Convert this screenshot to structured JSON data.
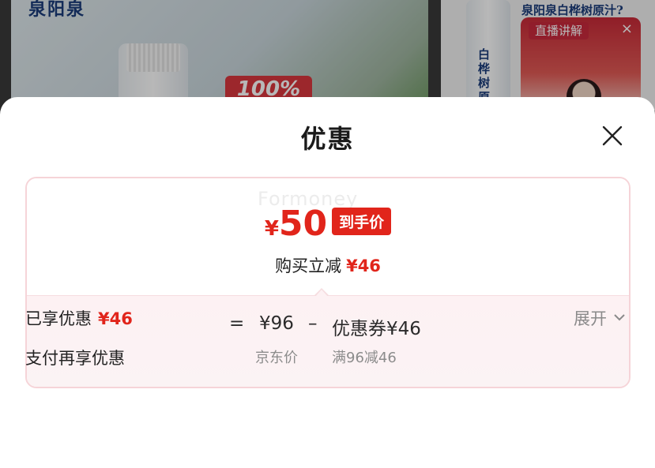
{
  "background": {
    "brand_text": "泉阳泉",
    "badge_text": "100%",
    "right_title": "泉阳泉白桦树原汁?",
    "bottle_label": "白桦树原",
    "live": {
      "label": "直播讲解",
      "close": "×"
    }
  },
  "sheet": {
    "title": "优惠",
    "close_icon": "close-icon"
  },
  "card": {
    "watermark": "Formoney",
    "price_symbol": "¥",
    "price_value": "50",
    "price_tag": "到手价",
    "reduce_label": "购买立减",
    "reduce_amount": "¥46",
    "formula": {
      "equals": "=",
      "jd_price": "¥96",
      "minus": "–",
      "coupon": "优惠券¥46"
    },
    "sub": {
      "jd_label": "京东价",
      "coupon_rule": "满96减46"
    }
  },
  "enjoyed": {
    "label": "已享优惠",
    "amount": "¥46",
    "expand": "展开"
  },
  "pay_more": {
    "label": "支付再享优惠"
  },
  "colors": {
    "accent": "#e1251b",
    "card_border": "#f6d4d8",
    "card_bottom_bg": "#fdf1f3"
  }
}
